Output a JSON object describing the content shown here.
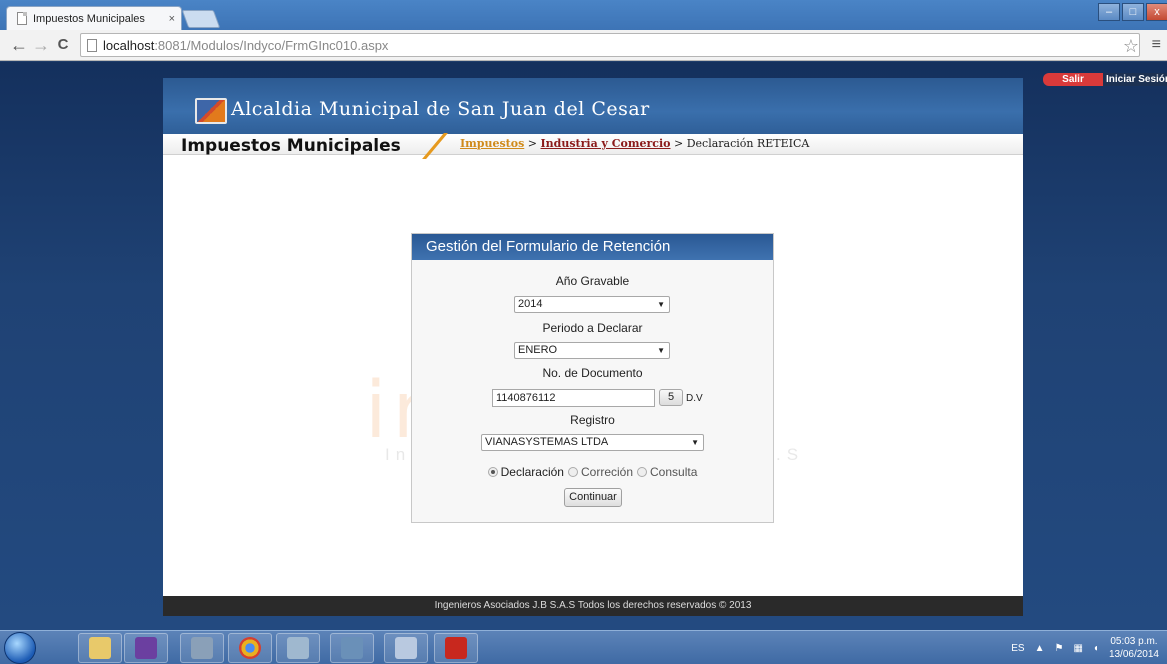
{
  "browser": {
    "tab_title": "Impuestos Municipales",
    "tab_close": "×",
    "url_host": "localhost",
    "url_path": ":8081/Modulos/Indyco/FrmGInc010.aspx",
    "back": "←",
    "forward": "→",
    "reload": "C",
    "star": "☆",
    "menu": "≡",
    "win_min": "–",
    "win_max": "□",
    "win_close": "x"
  },
  "topbar": {
    "salir": "Salir",
    "iniciar_sesion": "Iniciar Sesión"
  },
  "site": {
    "title": "Alcaldia Municipal de San Juan del Cesar",
    "section_title": "Impuestos Municipales",
    "breadcrumb": {
      "link1": "Impuestos",
      "sep1": " > ",
      "link2": "Industria y Comercio",
      "sep2": " > ",
      "current": "Declaración RETEICA"
    },
    "footer": "Ingenieros Asociados J.B S.A.S Todos los derechos reservados © 2013"
  },
  "watermark": {
    "main": "ingenias",
    "sub": "Ingenieros Asociados J.B S.A.S"
  },
  "form": {
    "heading": "Gestión del Formulario de Retención",
    "ano_label": "Año Gravable",
    "ano_value": "2014",
    "periodo_label": "Periodo a Declarar",
    "periodo_value": "ENERO",
    "documento_label": "No. de Documento",
    "documento_value": "1140876112",
    "dv_value": "5",
    "dv_label": "D.V",
    "registro_label": "Registro",
    "registro_value": "VIANASYSTEMAS LTDA",
    "radio_declaracion": "Declaración",
    "radio_correccion": "Correción",
    "radio_consulta": "Consulta",
    "continuar": "Continuar"
  },
  "taskbar": {
    "lang": "ES",
    "time": "05:03 p.m.",
    "date": "13/06/2014",
    "tray_arrow": "▲"
  }
}
